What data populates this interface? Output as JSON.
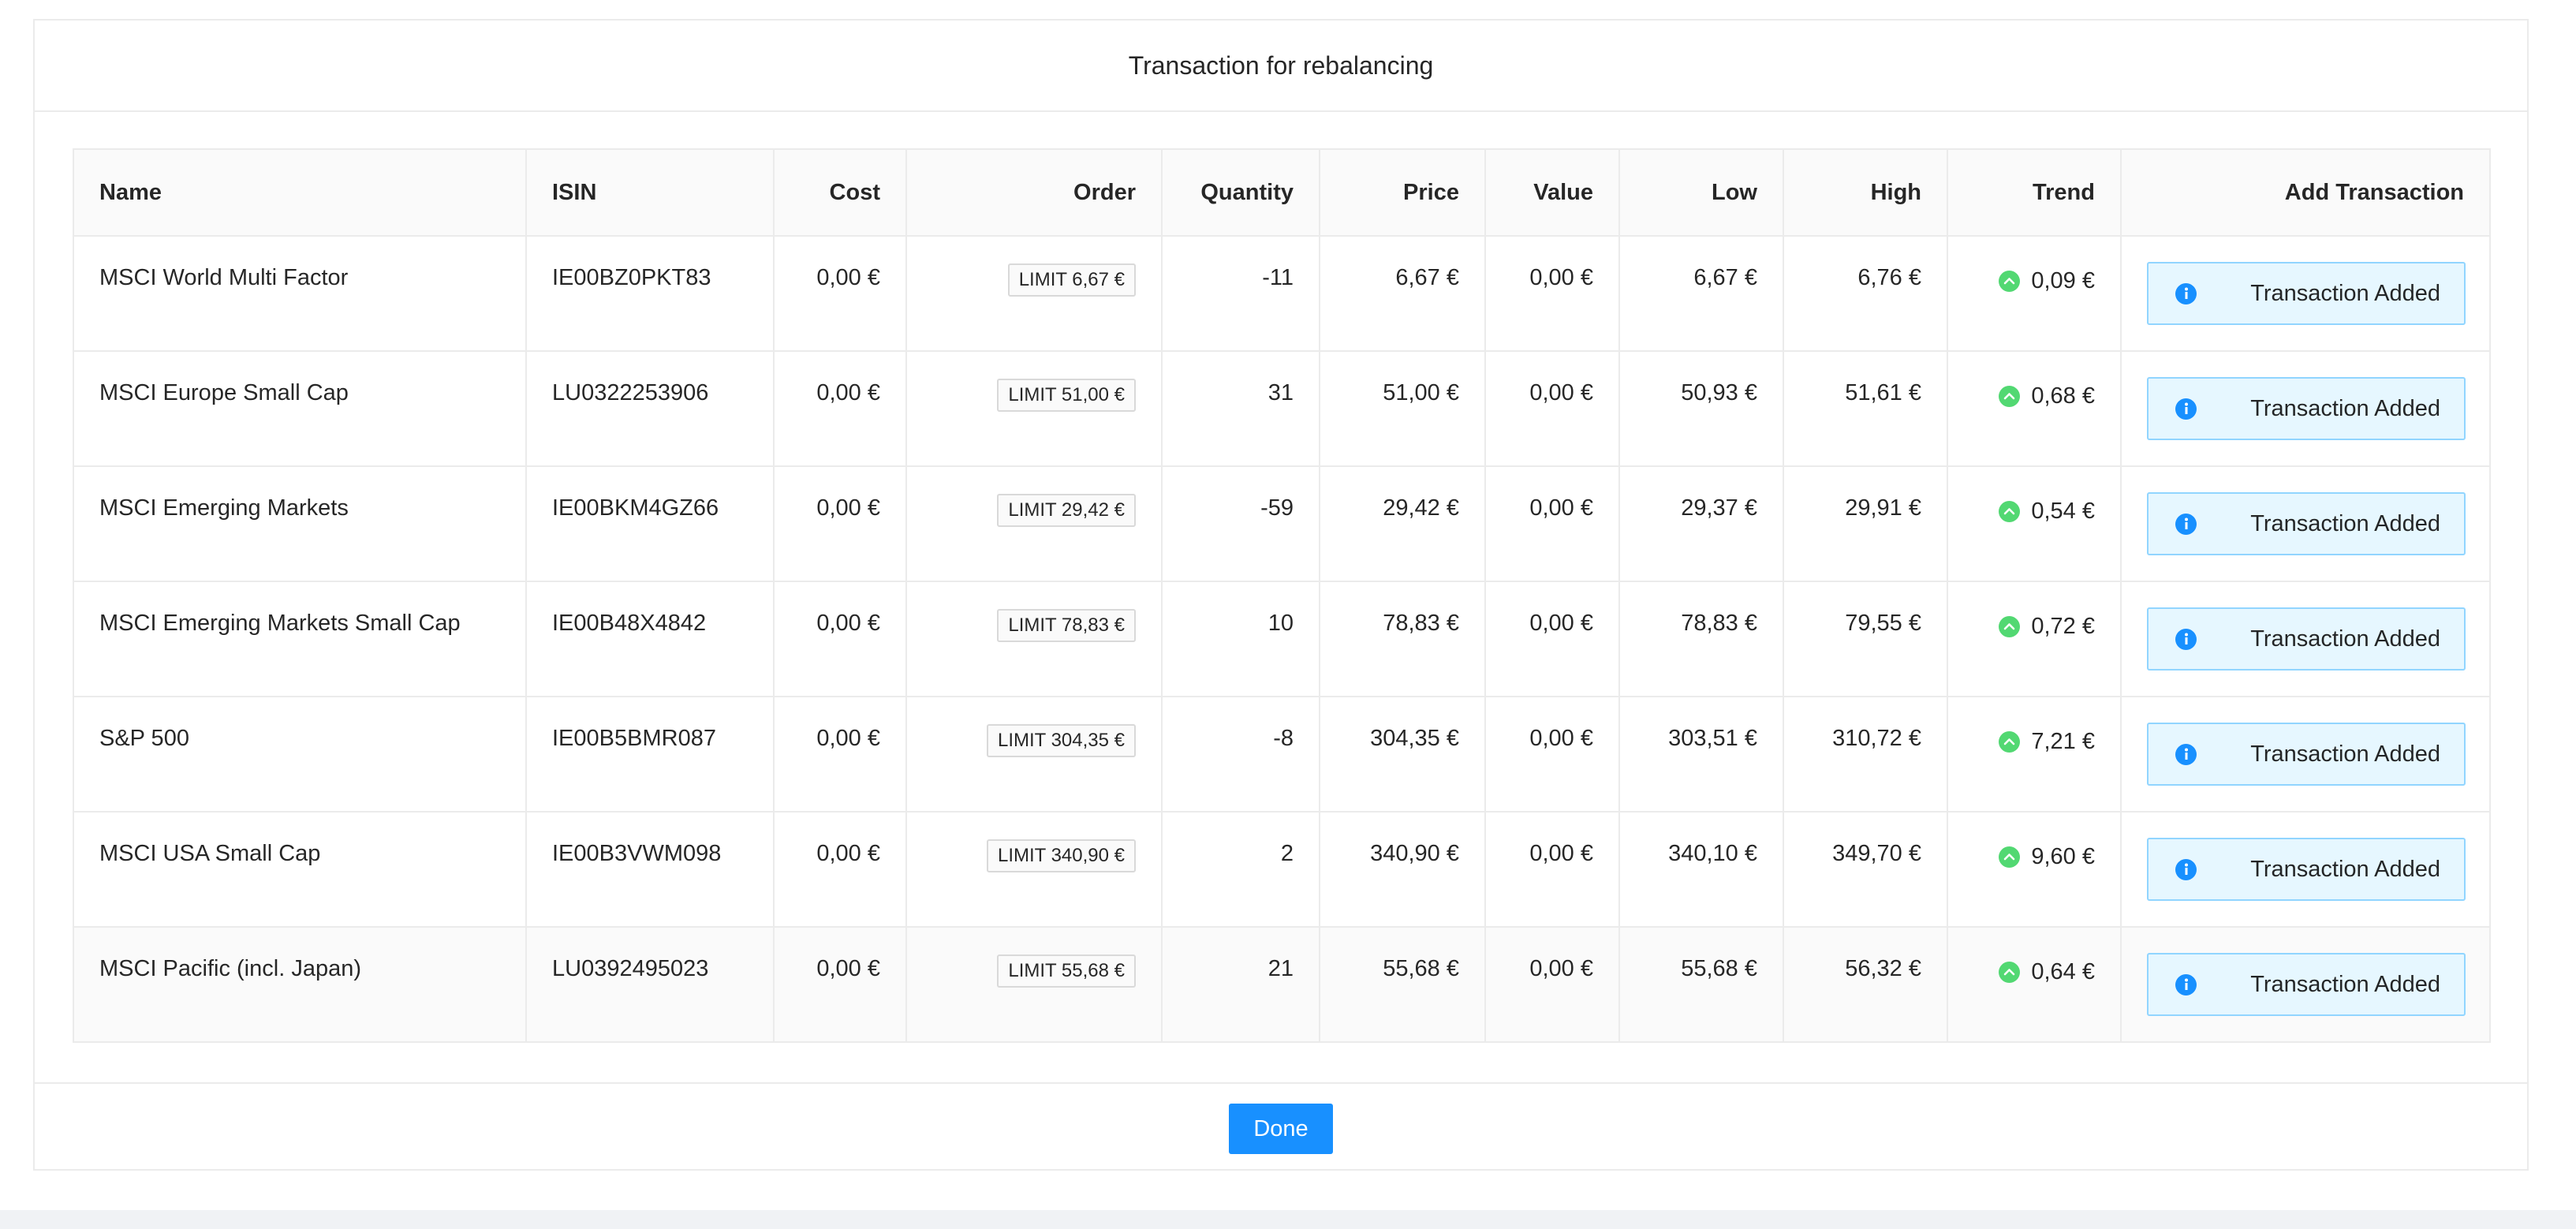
{
  "modal": {
    "title": "Transaction for rebalancing",
    "done_label": "Done"
  },
  "table": {
    "columns": [
      "Name",
      "ISIN",
      "Cost",
      "Order",
      "Quantity",
      "Price",
      "Value",
      "Low",
      "High",
      "Trend",
      "Add Transaction"
    ],
    "rows": [
      {
        "name": "MSCI World Multi Factor",
        "isin": "IE00BZ0PKT83",
        "cost": "0,00 €",
        "order": "LIMIT 6,67 €",
        "quantity": "-11",
        "price": "6,67 €",
        "value": "0,00 €",
        "low": "6,67 €",
        "high": "6,76 €",
        "trend": "0,09 €",
        "action": "Transaction Added"
      },
      {
        "name": "MSCI Europe Small Cap",
        "isin": "LU0322253906",
        "cost": "0,00 €",
        "order": "LIMIT 51,00 €",
        "quantity": "31",
        "price": "51,00 €",
        "value": "0,00 €",
        "low": "50,93 €",
        "high": "51,61 €",
        "trend": "0,68 €",
        "action": "Transaction Added"
      },
      {
        "name": "MSCI Emerging Markets",
        "isin": "IE00BKM4GZ66",
        "cost": "0,00 €",
        "order": "LIMIT 29,42 €",
        "quantity": "-59",
        "price": "29,42 €",
        "value": "0,00 €",
        "low": "29,37 €",
        "high": "29,91 €",
        "trend": "0,54 €",
        "action": "Transaction Added"
      },
      {
        "name": "MSCI Emerging Markets Small Cap",
        "isin": "IE00B48X4842",
        "cost": "0,00 €",
        "order": "LIMIT 78,83 €",
        "quantity": "10",
        "price": "78,83 €",
        "value": "0,00 €",
        "low": "78,83 €",
        "high": "79,55 €",
        "trend": "0,72 €",
        "action": "Transaction Added"
      },
      {
        "name": "S&P 500",
        "isin": "IE00B5BMR087",
        "cost": "0,00 €",
        "order": "LIMIT 304,35 €",
        "quantity": "-8",
        "price": "304,35 €",
        "value": "0,00 €",
        "low": "303,51 €",
        "high": "310,72 €",
        "trend": "7,21 €",
        "action": "Transaction Added"
      },
      {
        "name": "MSCI USA Small Cap",
        "isin": "IE00B3VWM098",
        "cost": "0,00 €",
        "order": "LIMIT 340,90 €",
        "quantity": "2",
        "price": "340,90 €",
        "value": "0,00 €",
        "low": "340,10 €",
        "high": "349,70 €",
        "trend": "9,60 €",
        "action": "Transaction Added"
      },
      {
        "name": "MSCI Pacific (incl. Japan)",
        "isin": "LU0392495023",
        "cost": "0,00 €",
        "order": "LIMIT 55,68 €",
        "quantity": "21",
        "price": "55,68 €",
        "value": "0,00 €",
        "low": "55,68 €",
        "high": "56,32 €",
        "trend": "0,64 €",
        "action": "Transaction Added"
      }
    ]
  },
  "icons": {
    "trend": "arrow-up-circle-icon",
    "action": "info-circle-icon"
  },
  "colors": {
    "primary": "#1890ff",
    "trend_up": "#52d872",
    "info_bg": "#e6f7ff",
    "info_border": "#91d5ff"
  }
}
